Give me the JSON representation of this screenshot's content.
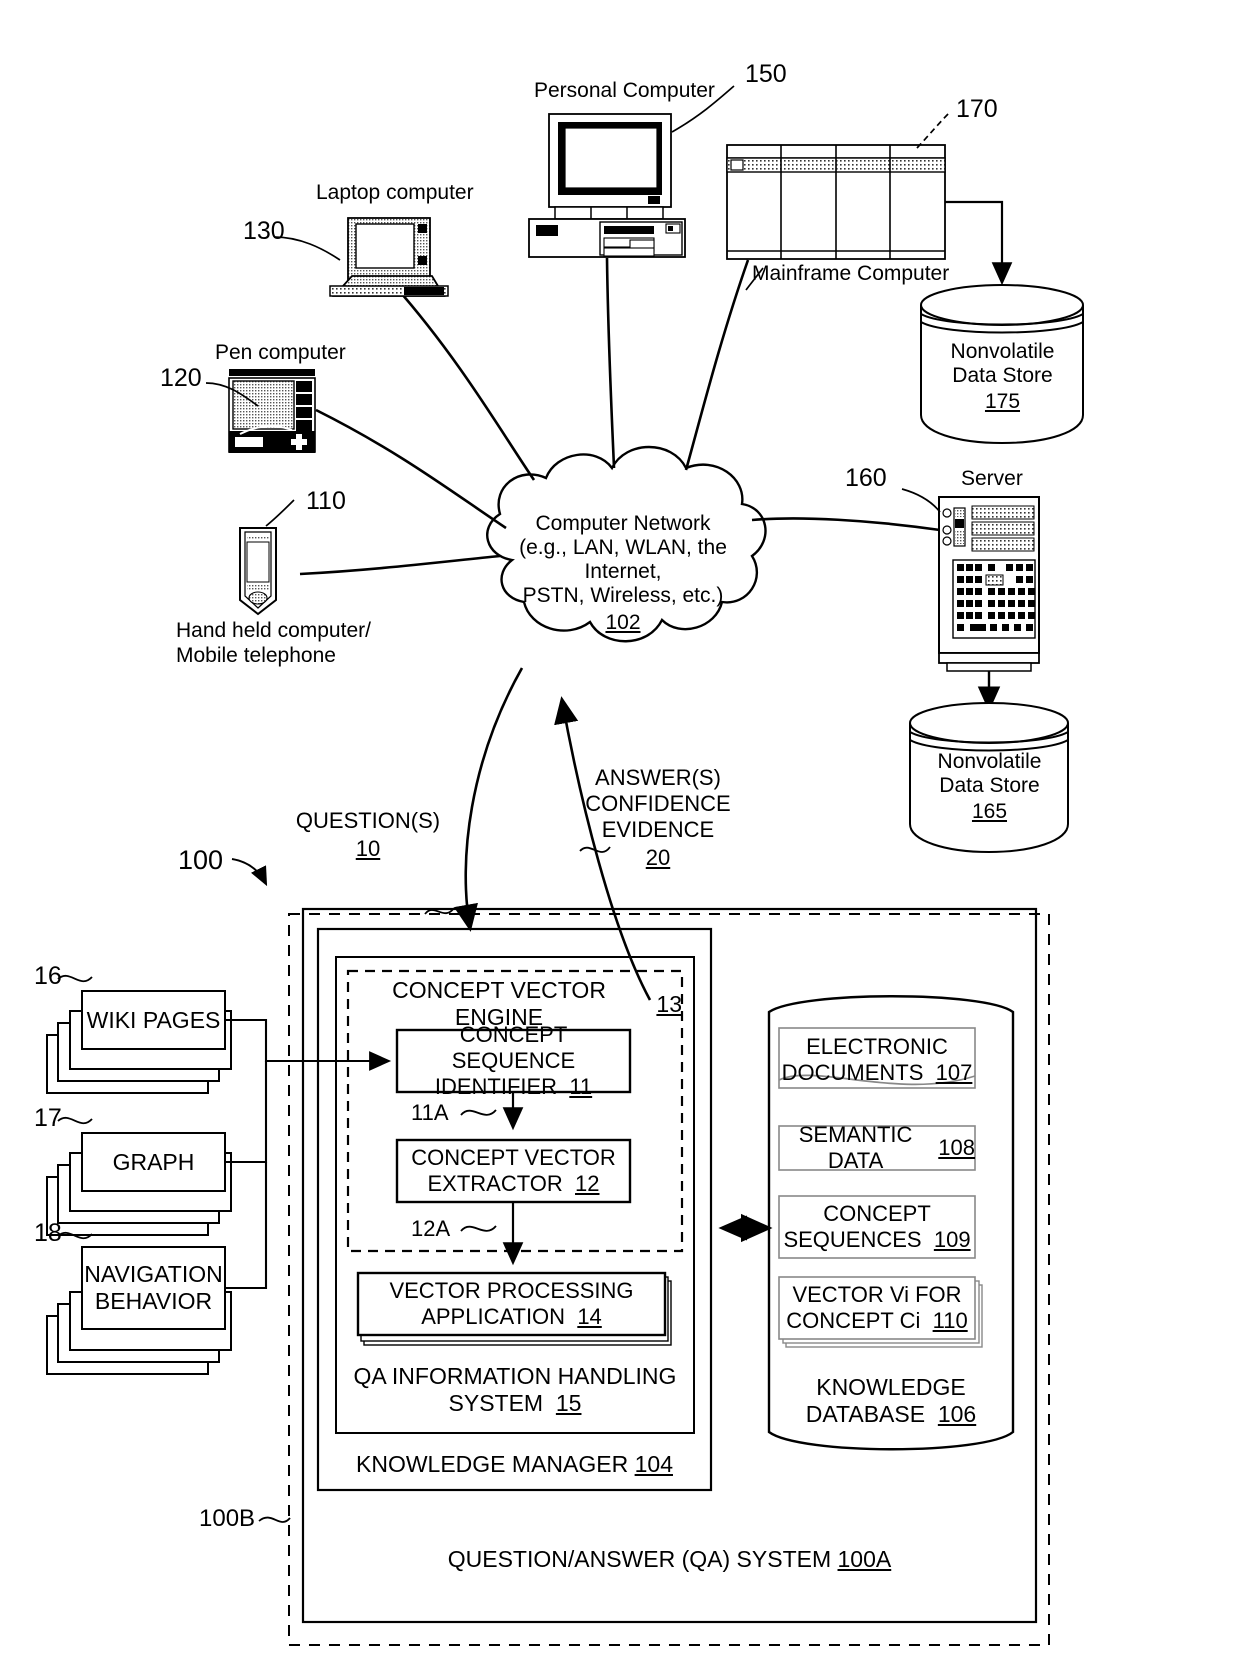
{
  "figure": {
    "system_ref": "100",
    "qa_system_label": "QUESTION/ANSWER (QA) SYSTEM",
    "qa_system_ref": "100A",
    "outer_ref": "100B"
  },
  "network": {
    "line1": "Computer Network",
    "line2": "(e.g., LAN, WLAN, the Internet,",
    "line3": "PSTN, Wireless, etc.)",
    "ref": "102"
  },
  "devices": [
    {
      "name": "handheld",
      "label_line1": "Hand held computer/",
      "label_line2": "Mobile telephone",
      "ref": "110"
    },
    {
      "name": "pen-computer",
      "label_line1": "Pen computer",
      "label_line2": "",
      "ref": "120"
    },
    {
      "name": "laptop",
      "label_line1": "Laptop computer",
      "label_line2": "",
      "ref": "130"
    },
    {
      "name": "personal-computer",
      "label_line1": "Personal Computer",
      "label_line2": "",
      "ref": "150"
    },
    {
      "name": "mainframe",
      "label_line1": "Mainframe Computer",
      "label_line2": "",
      "ref": "170"
    },
    {
      "name": "server",
      "label_line1": "Server",
      "label_line2": "",
      "ref": "160"
    }
  ],
  "data_stores": [
    {
      "name": "mainframe-store",
      "line1": "Nonvolatile",
      "line2": "Data Store",
      "ref": "175"
    },
    {
      "name": "server-store",
      "line1": "Nonvolatile",
      "line2": "Data Store",
      "ref": "165"
    }
  ],
  "flows": {
    "question_label": "QUESTION(S)",
    "question_ref": "10",
    "answer_line1": "ANSWER(S)",
    "answer_line2": "CONFIDENCE",
    "answer_line3": "EVIDENCE",
    "answer_ref": "20"
  },
  "sources": [
    {
      "label": "WIKI PAGES",
      "label2": "",
      "ref": "16"
    },
    {
      "label": "GRAPH",
      "label2": "",
      "ref": "17"
    },
    {
      "label": "NAVIGATION",
      "label2": "BEHAVIOR",
      "ref": "18"
    }
  ],
  "knowledge_manager": {
    "label": "KNOWLEDGE MANAGER",
    "ref": "104",
    "qa_ihs_line1": "QA INFORMATION HANDLING",
    "qa_ihs_line2": "SYSTEM",
    "qa_ihs_ref": "15",
    "engine_label": "CONCEPT VECTOR ENGINE",
    "engine_ref": "13",
    "blocks": [
      {
        "line1": "CONCEPT SEQUENCE",
        "line2": "IDENTIFIER",
        "ref": "11"
      },
      {
        "line1": "CONCEPT VECTOR",
        "line2": "EXTRACTOR",
        "ref": "12"
      },
      {
        "line1": "VECTOR PROCESSING",
        "line2": "APPLICATION",
        "ref": "14"
      }
    ],
    "connector_labels": [
      "11A",
      "12A"
    ]
  },
  "knowledge_database": {
    "label_line1": "KNOWLEDGE",
    "label_line2": "DATABASE",
    "ref": "106",
    "items": [
      {
        "line1": "ELECTRONIC",
        "line2": "DOCUMENTS",
        "ref": "107"
      },
      {
        "line1": "SEMANTIC DATA",
        "line2": "",
        "ref": "108"
      },
      {
        "line1": "CONCEPT",
        "line2": "SEQUENCES",
        "ref": "109"
      },
      {
        "line1": "VECTOR Vi FOR",
        "line2": "CONCEPT Ci",
        "ref": "110"
      }
    ]
  }
}
